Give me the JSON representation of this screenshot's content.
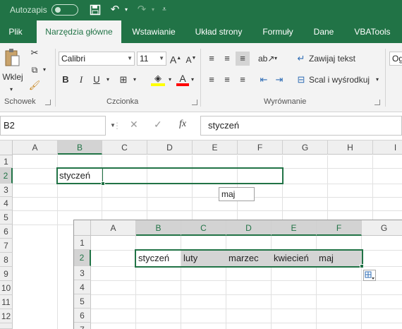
{
  "titlebar": {
    "autosave_label": "Autozapis",
    "save_icon": "save-icon",
    "undo_icon": "undo-icon",
    "redo_icon": "redo-icon",
    "customize_icon": "customize-qat-icon"
  },
  "tabs": [
    {
      "label": "Plik"
    },
    {
      "label": "Narzędzia główne"
    },
    {
      "label": "Wstawianie"
    },
    {
      "label": "Układ strony"
    },
    {
      "label": "Formuły"
    },
    {
      "label": "Dane"
    },
    {
      "label": "VBATools"
    }
  ],
  "ribbon": {
    "clipboard": {
      "paste_label": "Wklej",
      "group_label": "Schowek"
    },
    "font": {
      "font_name": "Calibri",
      "font_size": "11",
      "group_label": "Czcionka",
      "bold": "B",
      "italic": "I",
      "underline": "U"
    },
    "alignment": {
      "wrap_text": "Zawijaj tekst",
      "merge_center": "Scal i wyśrodkuj",
      "group_label": "Wyrównanie"
    },
    "next_group_partial": "Og",
    "colors": {
      "fill_color": "#ffff00",
      "font_color": "#ff0000",
      "accent": "#217346"
    }
  },
  "formula_bar": {
    "name_box": "B2",
    "fx_label": "fx",
    "value": "styczeń"
  },
  "main_grid": {
    "columns": [
      "A",
      "B",
      "C",
      "D",
      "E",
      "F",
      "G",
      "H",
      "I"
    ],
    "rows": [
      "1",
      "2",
      "3",
      "4",
      "5",
      "6",
      "7",
      "8",
      "9",
      "10",
      "11",
      "12"
    ],
    "b2_value": "styczeń",
    "drag_tooltip": "maj"
  },
  "inset_grid": {
    "columns": [
      "A",
      "B",
      "C",
      "D",
      "E",
      "F",
      "G"
    ],
    "rows": [
      "1",
      "2",
      "3",
      "4",
      "5",
      "6",
      "7"
    ],
    "row2_values": [
      "styczeń",
      "luty",
      "marzec",
      "kwiecień",
      "maj"
    ],
    "autofill_icon": "autofill-options-icon"
  }
}
